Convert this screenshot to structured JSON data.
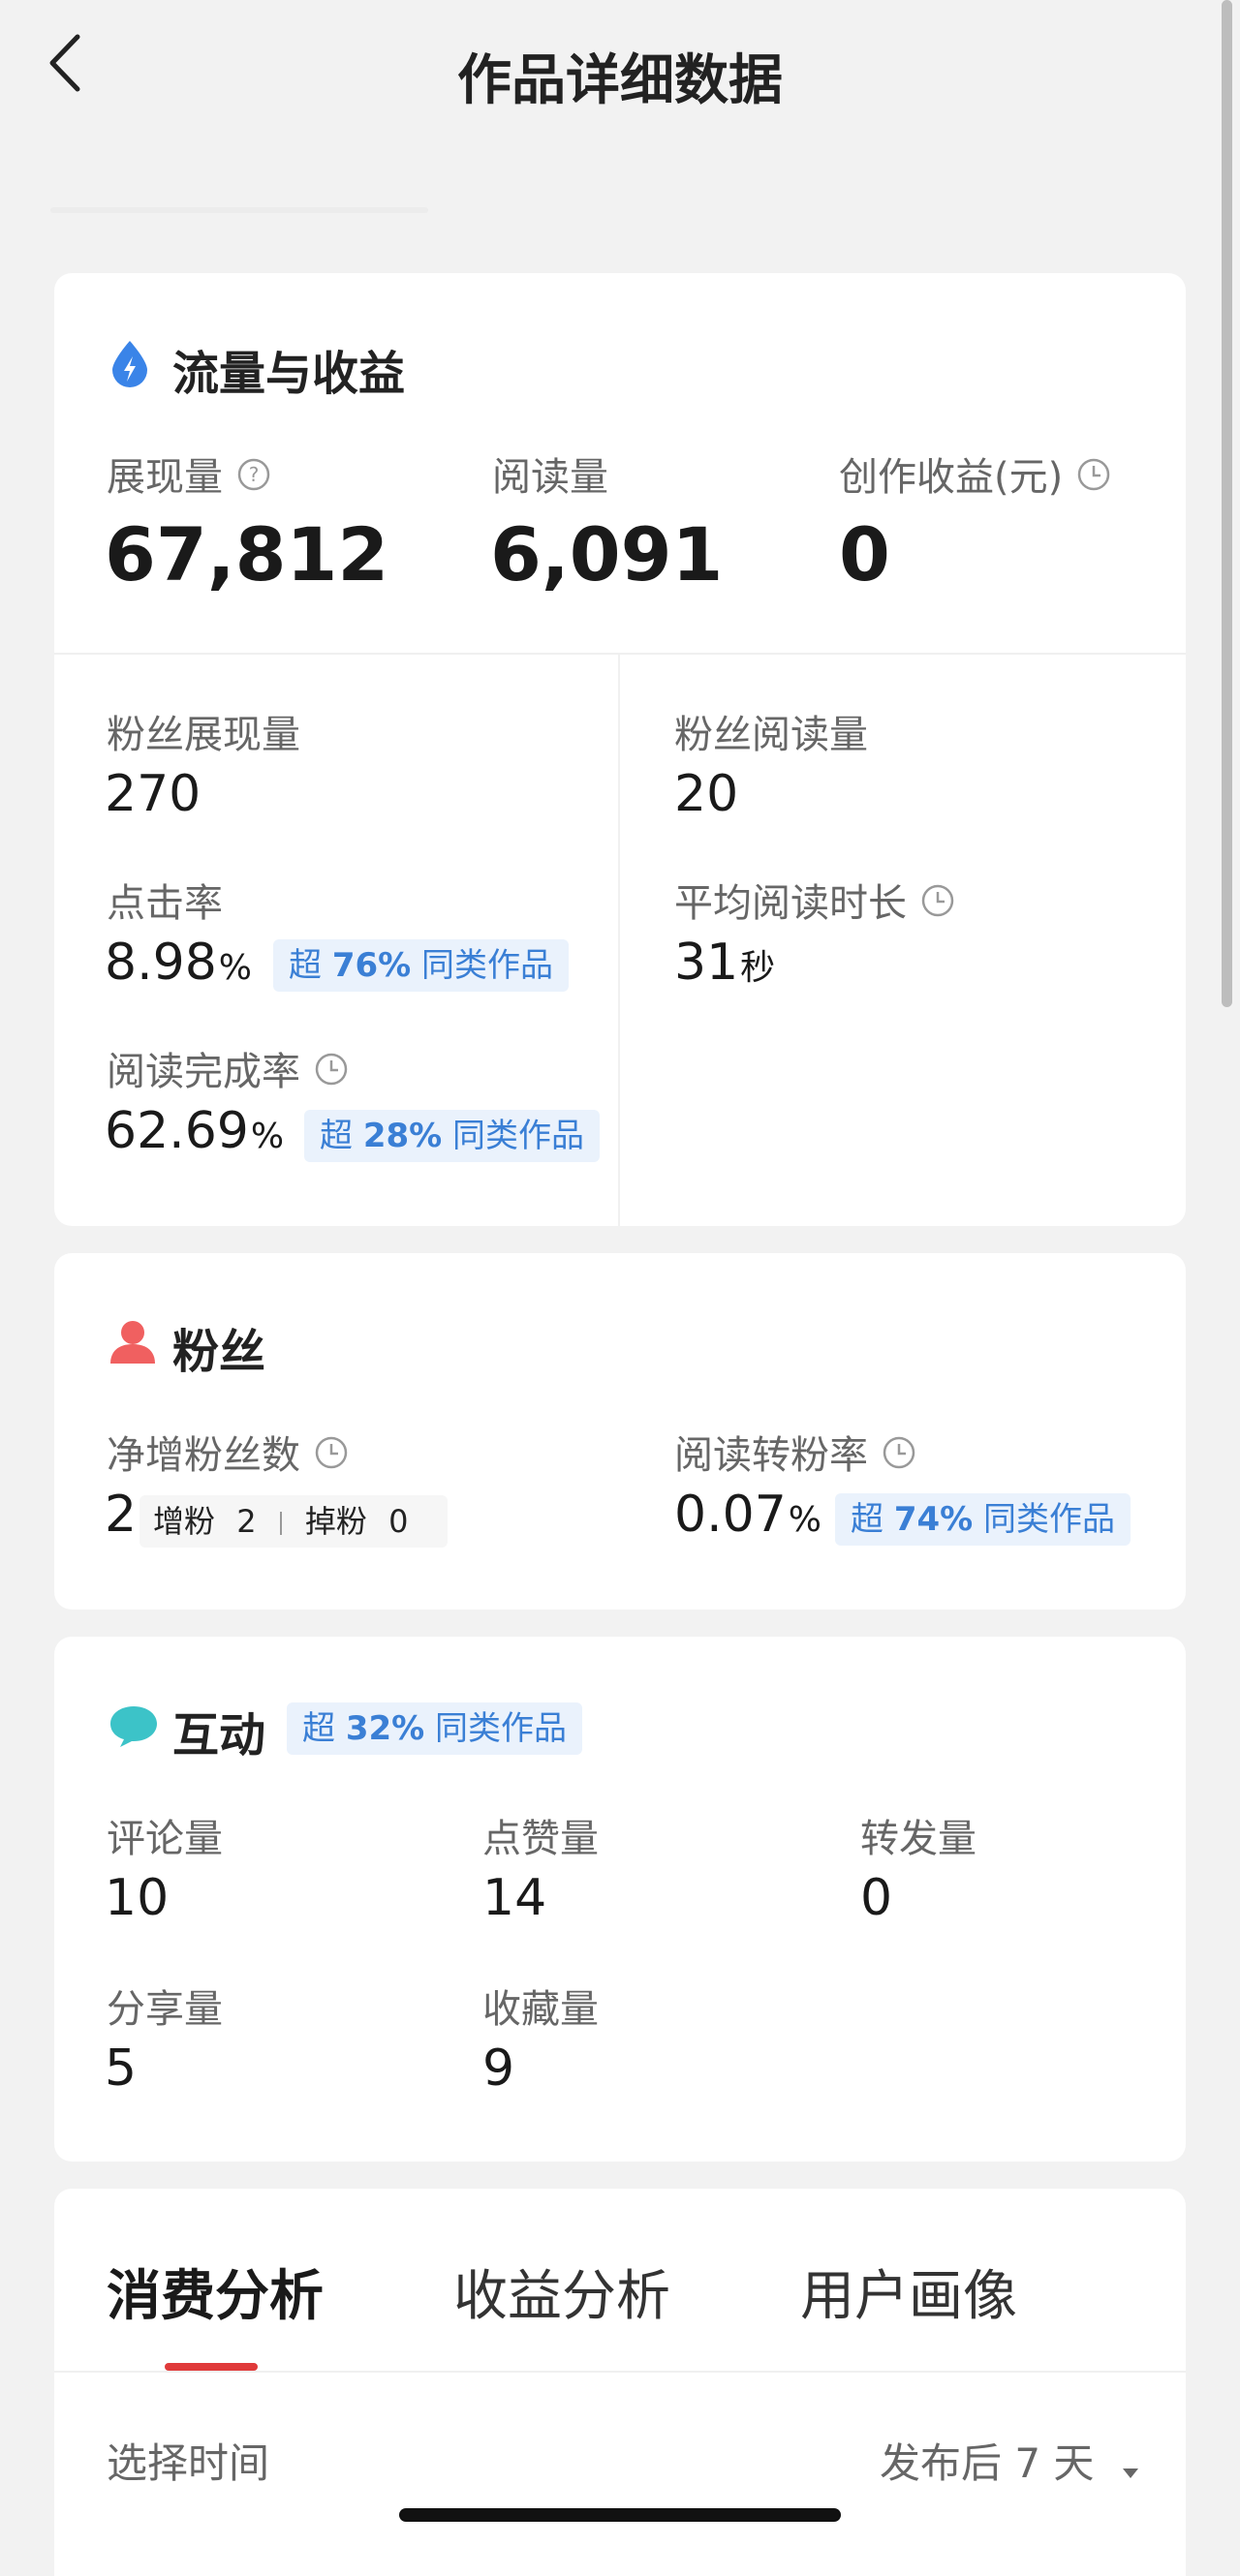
{
  "header": {
    "title": "作品详细数据",
    "back_icon": "chevron-left-icon"
  },
  "traffic": {
    "title": "流量与收益",
    "icon": "drop-lightning-icon",
    "metrics": [
      {
        "label": "展现量",
        "value": "67,812",
        "icon": "question-circle-icon"
      },
      {
        "label": "阅读量",
        "value": "6,091"
      },
      {
        "label": "创作收益(元)",
        "value": "0",
        "icon": "clock-icon"
      }
    ],
    "fan_impressions": {
      "label": "粉丝展现量",
      "value": "270"
    },
    "fan_reads": {
      "label": "粉丝阅读量",
      "value": "20"
    },
    "ctr": {
      "label": "点击率",
      "value": "8.98",
      "unit": "%",
      "badge_prefix": "超",
      "badge_value": "76%",
      "badge_suffix": "同类作品"
    },
    "avg_read_time": {
      "label": "平均阅读时长",
      "value": "31",
      "unit": "秒"
    },
    "completion": {
      "label": "阅读完成率",
      "value": "62.69",
      "unit": "%",
      "badge_prefix": "超",
      "badge_value": "28%",
      "badge_suffix": "同类作品"
    }
  },
  "fans": {
    "title": "粉丝",
    "icon": "user-icon",
    "net_gain": {
      "label": "净增粉丝数",
      "value": "2",
      "gain_label": "增粉",
      "gain_value": "2",
      "loss_label": "掉粉",
      "loss_value": "0"
    },
    "conversion": {
      "label": "阅读转粉率",
      "value": "0.07",
      "unit": "%",
      "badge_prefix": "超",
      "badge_value": "74%",
      "badge_suffix": "同类作品"
    }
  },
  "interaction": {
    "title": "互动",
    "icon": "chat-bubble-icon",
    "badge_prefix": "超",
    "badge_value": "32%",
    "badge_suffix": "同类作品",
    "metrics": [
      {
        "label": "评论量",
        "value": "10"
      },
      {
        "label": "点赞量",
        "value": "14"
      },
      {
        "label": "转发量",
        "value": "0"
      },
      {
        "label": "分享量",
        "value": "5"
      },
      {
        "label": "收藏量",
        "value": "9"
      }
    ]
  },
  "analysis": {
    "tabs": [
      "消费分析",
      "收益分析",
      "用户画像"
    ],
    "active_tab": 0,
    "time_label": "选择时间",
    "time_value": "发布后 7 天"
  },
  "colors": {
    "accent_red": "#e03a3a",
    "badge_blue": "#3a7fd5",
    "badge_bg": "#eaf2fc"
  }
}
